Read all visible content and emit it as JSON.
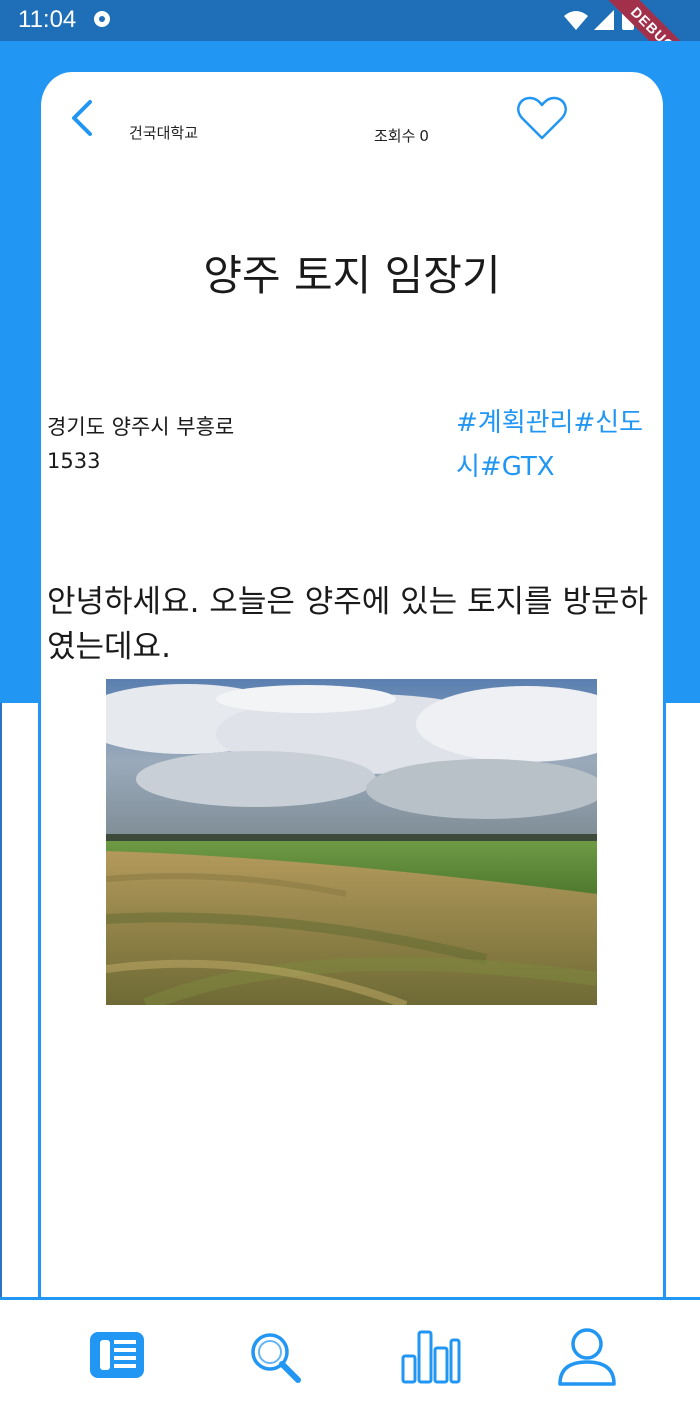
{
  "status_bar": {
    "time": "11:04",
    "debug_label": "DEBUG"
  },
  "header": {
    "university": "건국대학교",
    "views_label": "조회수",
    "views_count": "0"
  },
  "post": {
    "title": "양주 토지 임장기",
    "address": "경기도 양주시 부흥로 1533",
    "tags": "#계획관리#신도시#GTX",
    "body": "안녕하세요. 오늘은 양주에 있는 토지를 방문하였는데요."
  },
  "icons": {
    "back": "chevron-left-icon",
    "favorite": "heart-outline-icon",
    "nav": [
      "news-icon",
      "search-icon",
      "bar-chart-icon",
      "person-icon"
    ]
  },
  "colors": {
    "accent": "#2196f3",
    "status_bar": "#1f6fb8",
    "debug_banner": "#a2304a"
  }
}
